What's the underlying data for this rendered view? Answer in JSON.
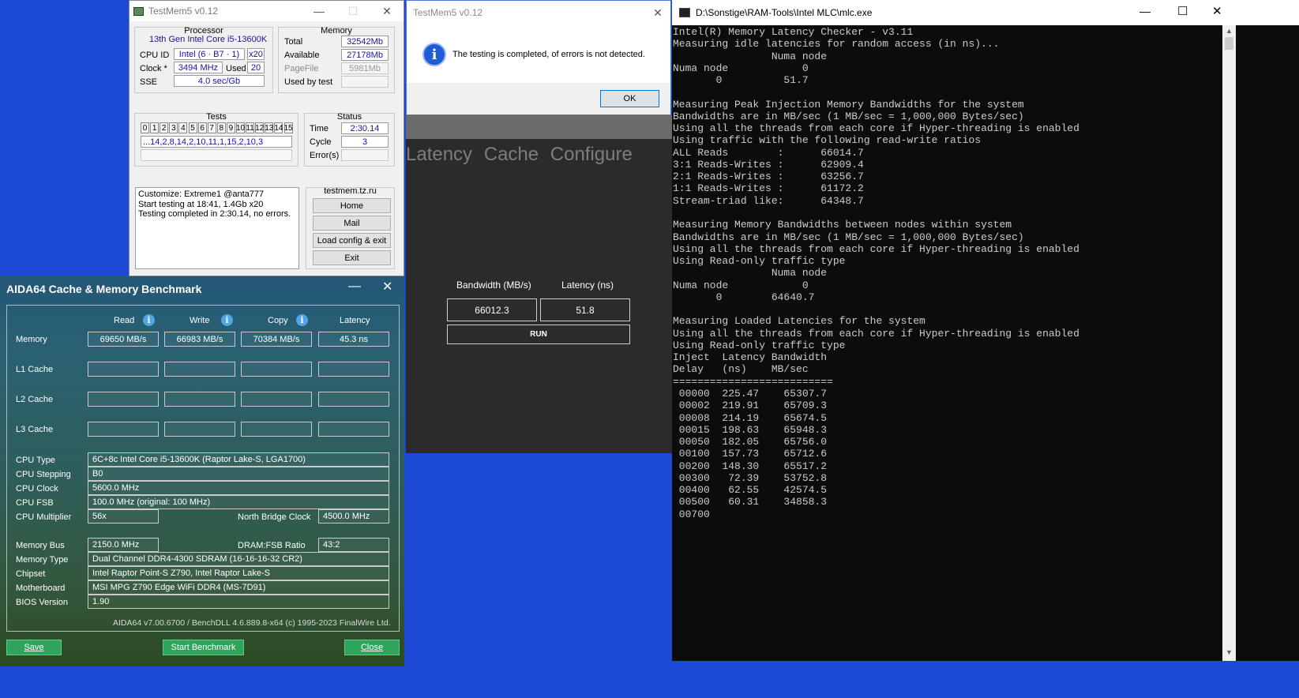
{
  "testmem_main": {
    "title": "TestMem5 v0.12",
    "processor": {
      "group": "Processor",
      "name": "13th Gen Intel Core i5-13600K",
      "cpu_id_label": "CPU ID",
      "cpu_id": "Intel (6 · B7 · 1)",
      "threads": "x20",
      "clock_label": "Clock *",
      "clock": "3494 MHz",
      "used_label": "Used",
      "used": "20",
      "sse_label": "SSE",
      "sse": "4.0 sec/Gb"
    },
    "memory": {
      "group": "Memory",
      "total_label": "Total",
      "total": "32542Mb",
      "available_label": "Available",
      "available": "27178Mb",
      "pagefile_label": "PageFile",
      "pagefile": "5981Mb",
      "used_by_test_label": "Used by test",
      "used_by_test": ""
    },
    "tests": {
      "group": "Tests",
      "numbers": [
        "0",
        "1",
        "2",
        "3",
        "4",
        "5",
        "6",
        "7",
        "8",
        "9",
        "10",
        "11",
        "12",
        "13",
        "14",
        "15"
      ],
      "sequence": "...14,2,8,14,2,10,11,1,15,2,10,3"
    },
    "status": {
      "group": "Status",
      "time_label": "Time",
      "time": "2:30.14",
      "cycle_label": "Cycle",
      "cycle": "3",
      "errors_label": "Error(s)",
      "errors": ""
    },
    "log": [
      "Customize: Extreme1 @anta777",
      "Start testing at 18:41, 1.4Gb x20",
      "Testing completed in 2:30.14, no errors."
    ],
    "links": {
      "group": "testmem.tz.ru",
      "home": "Home",
      "mail": "Mail",
      "load": "Load config & exit",
      "exit": "Exit"
    }
  },
  "testmem_dialog": {
    "title": "TestMem5 v0.12",
    "message": "The testing is completed, of errors is not detected.",
    "ok": "OK"
  },
  "latency_app": {
    "tabs": [
      "Latency",
      "Cache",
      "Configure"
    ],
    "bandwidth_label": "Bandwidth (MB/s)",
    "latency_label": "Latency (ns)",
    "bandwidth": "66012.3",
    "latency": "51.8",
    "run": "RUN"
  },
  "aida": {
    "title": "AIDA64 Cache & Memory Benchmark",
    "cols": {
      "read": "Read",
      "write": "Write",
      "copy": "Copy",
      "latency": "Latency"
    },
    "rows": {
      "memory": "Memory",
      "l1": "L1 Cache",
      "l2": "L2 Cache",
      "l3": "L3 Cache"
    },
    "memory": {
      "read": "69650 MB/s",
      "write": "66983 MB/s",
      "copy": "70384 MB/s",
      "latency": "45.3 ns"
    },
    "info": [
      {
        "label": "CPU Type",
        "value": "6C+8c Intel Core i5-13600K  (Raptor Lake-S, LGA1700)"
      },
      {
        "label": "CPU Stepping",
        "value": "B0"
      },
      {
        "label": "CPU Clock",
        "value": "5600.0 MHz"
      },
      {
        "label": "CPU FSB",
        "value": "100.0 MHz  (original: 100 MHz)"
      }
    ],
    "cpu_multiplier_label": "CPU Multiplier",
    "cpu_multiplier": "56x",
    "nb_clock_label": "North Bridge Clock",
    "nb_clock": "4500.0 MHz",
    "memory_bus_label": "Memory Bus",
    "memory_bus": "2150.0 MHz",
    "dram_ratio_label": "DRAM:FSB Ratio",
    "dram_ratio": "43:2",
    "info2": [
      {
        "label": "Memory Type",
        "value": "Dual Channel DDR4-4300 SDRAM  (16-16-16-32 CR2)"
      },
      {
        "label": "Chipset",
        "value": "Intel Raptor Point-S Z790, Intel Raptor Lake-S"
      },
      {
        "label": "Motherboard",
        "value": "MSI MPG Z790 Edge WiFi DDR4 (MS-7D91)"
      },
      {
        "label": "BIOS Version",
        "value": "1.90"
      }
    ],
    "footer": "AIDA64 v7.00.6700 / BenchDLL 4.6.889.8-x64  (c) 1995-2023 FinalWire Ltd.",
    "save": "Save",
    "start": "Start Benchmark",
    "close": "Close"
  },
  "console": {
    "title": "D:\\Sonstige\\RAM-Tools\\Intel MLC\\mlc.exe",
    "lines": [
      "Intel(R) Memory Latency Checker - v3.11",
      "Measuring idle latencies for random access (in ns)...",
      "                Numa node",
      "Numa node            0",
      "       0          51.7",
      "",
      "Measuring Peak Injection Memory Bandwidths for the system",
      "Bandwidths are in MB/sec (1 MB/sec = 1,000,000 Bytes/sec)",
      "Using all the threads from each core if Hyper-threading is enabled",
      "Using traffic with the following read-write ratios",
      "ALL Reads        :      66014.7",
      "3:1 Reads-Writes :      62909.4",
      "2:1 Reads-Writes :      63256.7",
      "1:1 Reads-Writes :      61172.2",
      "Stream-triad like:      64348.7",
      "",
      "Measuring Memory Bandwidths between nodes within system",
      "Bandwidths are in MB/sec (1 MB/sec = 1,000,000 Bytes/sec)",
      "Using all the threads from each core if Hyper-threading is enabled",
      "Using Read-only traffic type",
      "                Numa node",
      "Numa node            0",
      "       0        64640.7",
      "",
      "Measuring Loaded Latencies for the system",
      "Using all the threads from each core if Hyper-threading is enabled",
      "Using Read-only traffic type",
      "Inject  Latency Bandwidth",
      "Delay   (ns)    MB/sec",
      "==========================",
      " 00000  225.47    65307.7",
      " 00002  219.91    65709.3",
      " 00008  214.19    65674.5",
      " 00015  198.63    65948.3",
      " 00050  182.05    65756.0",
      " 00100  157.73    65712.6",
      " 00200  148.30    65517.2",
      " 00300   72.39    53752.8",
      " 00400   62.55    42574.5",
      " 00500   60.31    34858.3",
      " 00700"
    ]
  }
}
